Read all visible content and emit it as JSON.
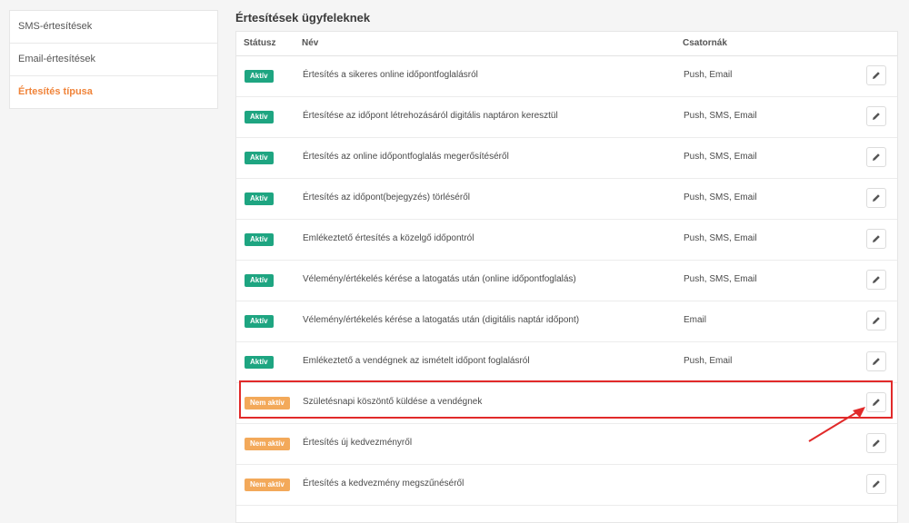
{
  "sidebar": {
    "items": [
      {
        "label": "SMS-értesítések"
      },
      {
        "label": "Email-értesítések"
      },
      {
        "label": "Értesítés típusa"
      }
    ]
  },
  "main": {
    "title": "Értesítések ügyfeleknek",
    "columns": {
      "status": "Státusz",
      "name": "Név",
      "channels": "Csatornák"
    }
  },
  "rows": [
    {
      "status": "Aktív",
      "name": "Értesítés a sikeres online időpontfoglalásról",
      "channels": "Push, Email"
    },
    {
      "status": "Aktív",
      "name": "Értesítése az időpont létrehozásáról digitális naptáron keresztül",
      "channels": "Push, SMS, Email"
    },
    {
      "status": "Aktív",
      "name": "Értesítés az online időpontfoglalás megerősítéséről",
      "channels": "Push, SMS, Email"
    },
    {
      "status": "Aktív",
      "name": "Értesítés az időpont(bejegyzés) törléséről",
      "channels": "Push, SMS, Email"
    },
    {
      "status": "Aktív",
      "name": "Emlékeztető értesítés a közelgő időpontról",
      "channels": "Push, SMS, Email"
    },
    {
      "status": "Aktív",
      "name": "Vélemény/értékelés kérése a latogatás után (online időpontfoglalás)",
      "channels": "Push, SMS, Email"
    },
    {
      "status": "Aktív",
      "name": "Vélemény/értékelés kérése a latogatás után (digitális naptár időpont)",
      "channels": "Email"
    },
    {
      "status": "Aktív",
      "name": "Emlékeztető a vendégnek az ismételt időpont foglalásról",
      "channels": "Push, Email"
    },
    {
      "status": "Nem aktív",
      "name": "Születésnapi köszöntő küldése a vendégnek",
      "channels": ""
    },
    {
      "status": "Nem aktív",
      "name": "Értesítés új kedvezményről",
      "channels": ""
    },
    {
      "status": "Nem aktív",
      "name": "Értesítés a kedvezmény megszűnéséről",
      "channels": ""
    }
  ],
  "colors": {
    "active_badge": "#1ea581",
    "inactive_badge": "#f3a95a",
    "highlight": "#e12a2a",
    "active_sidebar": "#f0843a"
  },
  "icons": {
    "edit": "pencil-icon"
  }
}
